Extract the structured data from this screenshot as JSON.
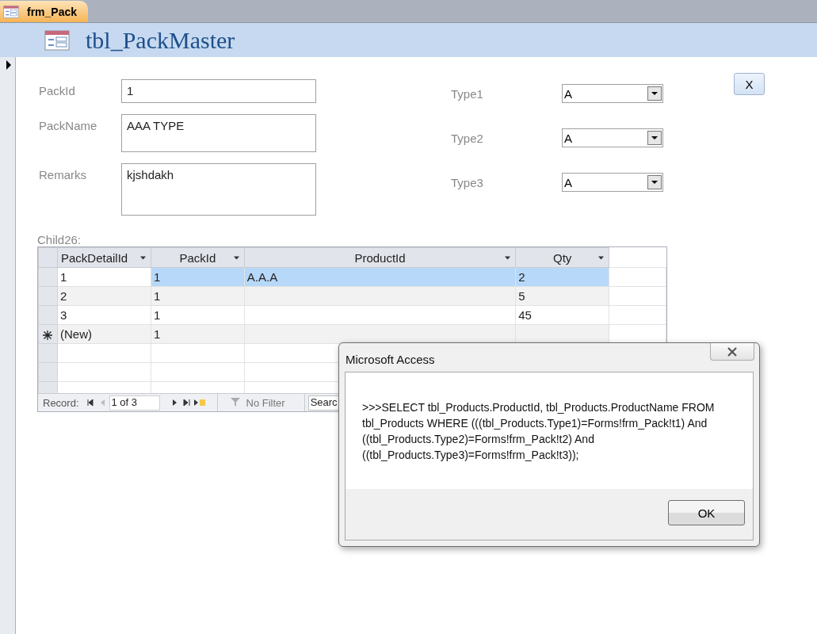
{
  "document_tabs": [
    {
      "label": "frm_Pack",
      "selected": true
    }
  ],
  "header": {
    "title": "tbl_PackMaster"
  },
  "fields": [
    {
      "label": "PackId",
      "value": "1",
      "kind": "single"
    },
    {
      "label": "PackName",
      "value": "AAA TYPE",
      "kind": "medium"
    },
    {
      "label": "Remarks",
      "value": "kjshdakh",
      "kind": "tall"
    }
  ],
  "combos": [
    {
      "label": "Type1",
      "value": "A"
    },
    {
      "label": "Type2",
      "value": "A"
    },
    {
      "label": "Type3",
      "value": "A"
    }
  ],
  "close_button": "X",
  "subform": {
    "label": "Child26:",
    "columns": [
      "PackDetailId",
      "PackId",
      "ProductId",
      "Qty"
    ],
    "rows": [
      {
        "kind": "record",
        "selected": true,
        "cells": [
          "1",
          "1",
          "A.A.A",
          "2"
        ]
      },
      {
        "kind": "record",
        "selected": false,
        "cells": [
          "2",
          "1",
          "",
          "5"
        ]
      },
      {
        "kind": "record",
        "selected": false,
        "cells": [
          "3",
          "1",
          "",
          "45"
        ]
      },
      {
        "kind": "new",
        "selected": false,
        "cells": [
          "(New)",
          "1",
          "",
          ""
        ]
      }
    ],
    "navigation": {
      "label": "Record:",
      "position": "1 of 3",
      "filter": "No Filter",
      "search": "Searc"
    }
  },
  "dialog": {
    "title": "Microsoft Access",
    "message": ">>>SELECT tbl_Products.ProductId, tbl_Products.ProductName FROM tbl_Products WHERE (((tbl_Products.Type1)=Forms!frm_Pack!t1) And ((tbl_Products.Type2)=Forms!frm_Pack!t2) And ((tbl_Products.Type3)=Forms!frm_Pack!t3));",
    "button": "OK"
  }
}
